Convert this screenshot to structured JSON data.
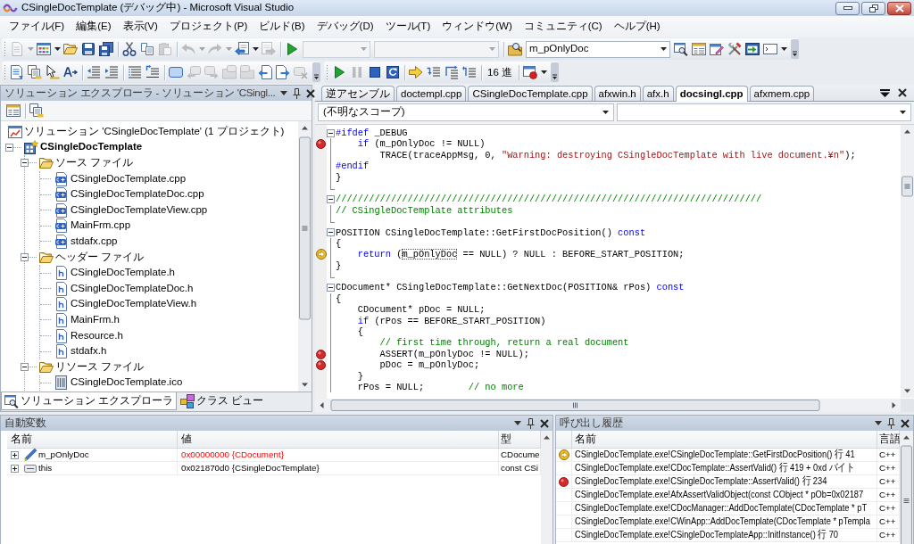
{
  "window": {
    "title": "CSingleDocTemplate (デバッグ中) - Microsoft Visual Studio"
  },
  "menu": [
    "ファイル(F)",
    "編集(E)",
    "表示(V)",
    "プロジェクト(P)",
    "ビルド(B)",
    "デバッグ(D)",
    "ツール(T)",
    "ウィンドウ(W)",
    "コミュニティ(C)",
    "ヘルプ(H)"
  ],
  "standard_toolbar": [
    {
      "kind": "split",
      "disabled": true
    },
    {
      "kind": "split",
      "disabled": false
    },
    {
      "kind": "button",
      "disabled": false
    },
    {
      "kind": "button",
      "disabled": false
    },
    {
      "kind": "button",
      "disabled": false
    },
    {
      "kind": "separator"
    },
    {
      "kind": "button",
      "disabled": false
    },
    {
      "kind": "button",
      "disabled": false
    },
    {
      "kind": "button",
      "disabled": true
    },
    {
      "kind": "separator"
    },
    {
      "kind": "split",
      "disabled": true
    },
    {
      "kind": "split",
      "disabled": true
    },
    {
      "kind": "split",
      "disabled": false
    },
    {
      "kind": "button",
      "disabled": true
    },
    {
      "kind": "separator"
    },
    {
      "kind": "button",
      "disabled": false
    },
    {
      "kind": "combo",
      "disabled": true
    },
    {
      "kind": "combo",
      "disabled": true
    },
    {
      "kind": "separator"
    },
    {
      "kind": "button",
      "disabled": false
    },
    {
      "kind": "combo",
      "disabled": false,
      "value": "m_pOnlyDoc"
    },
    {
      "kind": "button",
      "disabled": false
    },
    {
      "kind": "button",
      "disabled": false
    },
    {
      "kind": "button",
      "disabled": false
    },
    {
      "kind": "button",
      "disabled": false
    },
    {
      "kind": "button",
      "disabled": false
    },
    {
      "kind": "split",
      "disabled": false
    },
    {
      "kind": "overflow"
    }
  ],
  "text_editor_toolbar": [
    {
      "kind": "button",
      "disabled": false
    },
    {
      "kind": "button",
      "disabled": false
    },
    {
      "kind": "button",
      "disabled": false
    },
    {
      "kind": "button",
      "disabled": false
    },
    {
      "kind": "separator"
    },
    {
      "kind": "button",
      "disabled": false
    },
    {
      "kind": "button",
      "disabled": false
    },
    {
      "kind": "separator"
    },
    {
      "kind": "button",
      "disabled": false
    },
    {
      "kind": "button",
      "disabled": false
    },
    {
      "kind": "separator"
    },
    {
      "kind": "button",
      "disabled": false
    },
    {
      "kind": "button",
      "disabled": true
    },
    {
      "kind": "button",
      "disabled": true
    },
    {
      "kind": "button",
      "disabled": true
    },
    {
      "kind": "button",
      "disabled": true
    },
    {
      "kind": "button",
      "disabled": false
    },
    {
      "kind": "button",
      "disabled": false
    },
    {
      "kind": "button",
      "disabled": true
    },
    {
      "kind": "overflow"
    }
  ],
  "debug_toolbar": [
    {
      "kind": "button",
      "disabled": false
    },
    {
      "kind": "button",
      "disabled": true
    },
    {
      "kind": "button",
      "disabled": false
    },
    {
      "kind": "button",
      "disabled": false
    },
    {
      "kind": "separator"
    },
    {
      "kind": "button",
      "disabled": false
    },
    {
      "kind": "button",
      "disabled": false
    },
    {
      "kind": "button",
      "disabled": false
    },
    {
      "kind": "button",
      "disabled": false
    },
    {
      "kind": "separator"
    },
    {
      "kind": "text",
      "label": "16 進",
      "disabled": false
    },
    {
      "kind": "separator"
    },
    {
      "kind": "split",
      "disabled": false
    },
    {
      "kind": "overflow"
    }
  ],
  "solution_explorer": {
    "title": "ソリューション エクスプローラ - ソリューション 'CSingl...",
    "toolbar": [
      {
        "kind": "button",
        "disabled": false
      },
      {
        "kind": "separator"
      },
      {
        "kind": "button",
        "disabled": false
      }
    ],
    "tree": [
      {
        "label": "ソリューション 'CSingleDocTemplate' (1 プロジェクト)",
        "kind": "solution",
        "children": [
          {
            "label": "CSingleDocTemplate",
            "kind": "project",
            "expanded": true,
            "children": [
              {
                "label": "ソース ファイル",
                "kind": "folder",
                "expanded": true,
                "children": [
                  {
                    "label": "CSingleDocTemplate.cpp",
                    "kind": "cpp"
                  },
                  {
                    "label": "CSingleDocTemplateDoc.cpp",
                    "kind": "cpp"
                  },
                  {
                    "label": "CSingleDocTemplateView.cpp",
                    "kind": "cpp"
                  },
                  {
                    "label": "MainFrm.cpp",
                    "kind": "cpp"
                  },
                  {
                    "label": "stdafx.cpp",
                    "kind": "cpp"
                  }
                ]
              },
              {
                "label": "ヘッダー ファイル",
                "kind": "folder",
                "expanded": true,
                "children": [
                  {
                    "label": "CSingleDocTemplate.h",
                    "kind": "header"
                  },
                  {
                    "label": "CSingleDocTemplateDoc.h",
                    "kind": "header"
                  },
                  {
                    "label": "CSingleDocTemplateView.h",
                    "kind": "header"
                  },
                  {
                    "label": "MainFrm.h",
                    "kind": "header"
                  },
                  {
                    "label": "Resource.h",
                    "kind": "header"
                  },
                  {
                    "label": "stdafx.h",
                    "kind": "header"
                  }
                ]
              },
              {
                "label": "リソース ファイル",
                "kind": "folder",
                "expanded": true,
                "children": [
                  {
                    "label": "CSingleDocTemplate.ico",
                    "kind": "icon"
                  }
                ]
              }
            ]
          }
        ]
      }
    ],
    "tabs": [
      {
        "label": "ソリューション エクスプローラ",
        "selected": true
      },
      {
        "label": "クラス ビュー",
        "selected": false
      }
    ]
  },
  "editor": {
    "tabs": [
      {
        "label": "逆アセンブル",
        "selected": false
      },
      {
        "label": "doctempl.cpp",
        "selected": false
      },
      {
        "label": "CSingleDocTemplate.cpp",
        "selected": false
      },
      {
        "label": "afxwin.h",
        "selected": false
      },
      {
        "label": "afx.h",
        "selected": false
      },
      {
        "label": "docsingl.cpp",
        "selected": true
      },
      {
        "label": "afxmem.cpp",
        "selected": false
      }
    ],
    "scope": {
      "value": "(不明なスコープ)"
    },
    "lines": [
      {
        "kind": "start",
        "breakpoint": false,
        "current": false,
        "parts": [
          {
            "kind": "keyword",
            "text": "#ifdef"
          },
          {
            "kind": "plain",
            "text": " _DEBUG"
          }
        ]
      },
      {
        "kind": "inner",
        "breakpoint": true,
        "current": false,
        "parts": [
          {
            "kind": "keyword",
            "text": "    if"
          },
          {
            "kind": "plain",
            "text": " (m_pOnlyDoc != NULL)"
          }
        ]
      },
      {
        "kind": "inner",
        "breakpoint": false,
        "current": false,
        "parts": [
          {
            "kind": "plain",
            "text": "        TRACE(traceAppMsg, 0, "
          },
          {
            "kind": "string",
            "text": "\"Warning: destroying CSingleDocTemplate with live document.¥n\""
          },
          {
            "kind": "plain",
            "text": ");"
          }
        ]
      },
      {
        "kind": "inner",
        "breakpoint": false,
        "current": false,
        "parts": [
          {
            "kind": "keyword",
            "text": "#endif"
          }
        ]
      },
      {
        "kind": "inner",
        "breakpoint": false,
        "current": false,
        "parts": [
          {
            "kind": "plain",
            "text": "}"
          }
        ]
      },
      {
        "kind": "end",
        "breakpoint": false,
        "current": false
      },
      {
        "kind": "start",
        "breakpoint": false,
        "current": false,
        "parts": [
          {
            "kind": "comment",
            "text": "/////////////////////////////////////////////////////////////////////////////"
          }
        ]
      },
      {
        "kind": "inner",
        "breakpoint": false,
        "current": false,
        "parts": [
          {
            "kind": "comment",
            "text": "// CSingleDocTemplate attributes"
          }
        ]
      },
      {
        "kind": "end",
        "breakpoint": false,
        "current": false
      },
      {
        "kind": "start",
        "breakpoint": false,
        "current": false,
        "parts": [
          {
            "kind": "plain",
            "text": "POSITION CSingleDocTemplate::GetFirstDocPosition() "
          },
          {
            "kind": "keyword",
            "text": "const"
          }
        ]
      },
      {
        "kind": "inner",
        "breakpoint": false,
        "current": false,
        "parts": [
          {
            "kind": "plain",
            "text": "{"
          }
        ]
      },
      {
        "kind": "inner",
        "breakpoint": false,
        "current": true,
        "parts": [
          {
            "kind": "keyword",
            "text": "    return"
          },
          {
            "kind": "plain",
            "text": " ("
          },
          {
            "kind": "boxed",
            "text": "m_pOnlyDoc"
          },
          {
            "kind": "plain",
            "text": " == NULL) ? NULL : BEFORE_START_POSITION;"
          }
        ]
      },
      {
        "kind": "inner",
        "breakpoint": false,
        "current": false,
        "parts": [
          {
            "kind": "plain",
            "text": "}"
          }
        ]
      },
      {
        "kind": "end",
        "breakpoint": false,
        "current": false
      },
      {
        "kind": "start",
        "breakpoint": false,
        "current": false,
        "parts": [
          {
            "kind": "plain",
            "text": "CDocument* CSingleDocTemplate::GetNextDoc(POSITION& rPos) "
          },
          {
            "kind": "keyword",
            "text": "const"
          }
        ]
      },
      {
        "kind": "inner",
        "breakpoint": false,
        "current": false,
        "parts": [
          {
            "kind": "plain",
            "text": "{"
          }
        ]
      },
      {
        "kind": "inner",
        "breakpoint": false,
        "current": false,
        "parts": [
          {
            "kind": "plain",
            "text": "    CDocument* pDoc = NULL;"
          }
        ]
      },
      {
        "kind": "inner",
        "breakpoint": false,
        "current": false,
        "parts": [
          {
            "kind": "keyword",
            "text": "    if"
          },
          {
            "kind": "plain",
            "text": " (rPos == BEFORE_START_POSITION)"
          }
        ]
      },
      {
        "kind": "inner",
        "breakpoint": false,
        "current": false,
        "parts": [
          {
            "kind": "plain",
            "text": "    {"
          }
        ]
      },
      {
        "kind": "inner",
        "breakpoint": false,
        "current": false,
        "parts": [
          {
            "kind": "comment",
            "text": "        // first time through, return a real document"
          }
        ]
      },
      {
        "kind": "inner",
        "breakpoint": true,
        "current": false,
        "parts": [
          {
            "kind": "plain",
            "text": "        ASSERT(m_pOnlyDoc != NULL);"
          }
        ]
      },
      {
        "kind": "inner",
        "breakpoint": true,
        "current": false,
        "parts": [
          {
            "kind": "plain",
            "text": "        pDoc = m_pOnlyDoc;"
          }
        ]
      },
      {
        "kind": "inner",
        "breakpoint": false,
        "current": false,
        "parts": [
          {
            "kind": "plain",
            "text": "    }"
          }
        ]
      },
      {
        "kind": "inner",
        "breakpoint": false,
        "current": false,
        "parts": [
          {
            "kind": "plain",
            "text": "    rPos = NULL;        "
          },
          {
            "kind": "comment",
            "text": "// no more"
          }
        ]
      }
    ]
  },
  "autos": {
    "title": "自動変数",
    "columns": [
      "名前",
      "値",
      "型"
    ],
    "rows": [
      {
        "kind": "field",
        "name": "m_pOnlyDoc",
        "value": "0x00000000 {CDocument}",
        "type": "CDocume",
        "expanded": false,
        "changed": true
      },
      {
        "kind": "local",
        "name": "this",
        "value": "0x021870d0 {CSingleDocTemplate}",
        "type": "const CSi",
        "expanded": false,
        "changed": false
      }
    ]
  },
  "call_stack": {
    "title": "呼び出し履歴",
    "columns": [
      "名前",
      "言語"
    ],
    "rows": [
      {
        "current": true,
        "breakpoint": false,
        "name": "CSingleDocTemplate.exe!CSingleDocTemplate::GetFirstDocPosition() 行 41",
        "language": "C++"
      },
      {
        "current": false,
        "breakpoint": false,
        "name": "CSingleDocTemplate.exe!CDocTemplate::AssertValid() 行 419 + 0xd バイト",
        "language": "C++"
      },
      {
        "current": false,
        "breakpoint": true,
        "name": "CSingleDocTemplate.exe!CSingleDocTemplate::AssertValid() 行 234",
        "language": "C++"
      },
      {
        "current": false,
        "breakpoint": false,
        "name": "CSingleDocTemplate.exe!AfxAssertValidObject(const CObject * pOb=0x02187",
        "language": "C++"
      },
      {
        "current": false,
        "breakpoint": false,
        "name": "CSingleDocTemplate.exe!CDocManager::AddDocTemplate(CDocTemplate * pT",
        "language": "C++"
      },
      {
        "current": false,
        "breakpoint": false,
        "name": "CSingleDocTemplate.exe!CWinApp::AddDocTemplate(CDocTemplate * pTempla",
        "language": "C++"
      },
      {
        "current": false,
        "breakpoint": false,
        "name": "CSingleDocTemplate.exe!CSingleDocTemplateApp::InitInstance() 行 70",
        "language": "C++"
      }
    ]
  }
}
